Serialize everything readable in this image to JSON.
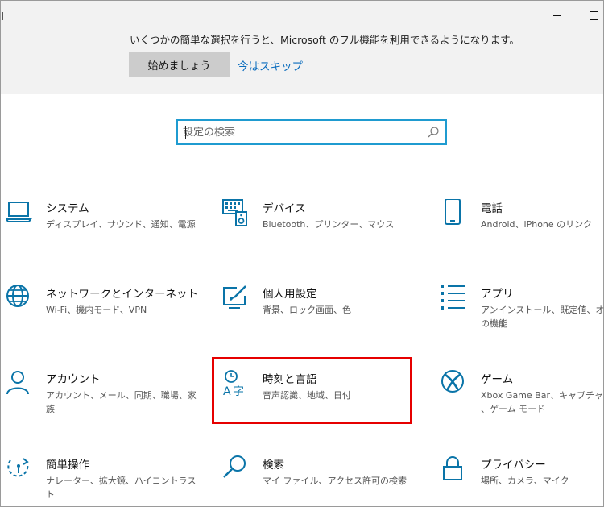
{
  "banner": {
    "message": "いくつかの簡単な選択を行うと、Microsoft のフル機能を利用できるようになります。",
    "start_label": "始めましょう",
    "skip_label": "今はスキップ"
  },
  "search": {
    "placeholder": "設定の検索"
  },
  "colors": {
    "accent": "#0a74a8",
    "link": "#0a6cbd",
    "highlight": "#e60000"
  },
  "tiles": [
    {
      "title": "システム",
      "desc": "ディスプレイ、サウンド、通知、電源",
      "icon": "laptop-icon"
    },
    {
      "title": "デバイス",
      "desc": "Bluetooth、プリンター、マウス",
      "icon": "keyboard-speaker-icon"
    },
    {
      "title": "電話",
      "desc": "Android、iPhone のリンク",
      "icon": "phone-icon"
    },
    {
      "title": "ネットワークとインターネット",
      "desc": "Wi-Fi、機内モード、VPN",
      "icon": "globe-icon"
    },
    {
      "title": "個人用設定",
      "desc": "背景、ロック画面、色",
      "icon": "paint-brush-icon"
    },
    {
      "title": "アプリ",
      "desc": "アンインストール、既定値、オプショ\nの機能",
      "icon": "app-list-icon"
    },
    {
      "title": "アカウント",
      "desc": "アカウント、メール、同期、職場、家\n族",
      "icon": "person-icon"
    },
    {
      "title": "時刻と言語",
      "desc": "音声認識、地域、日付",
      "icon": "time-language-icon"
    },
    {
      "title": "ゲーム",
      "desc": "Xbox Game Bar、キャプチャ、ゲ\n、ゲーム モード",
      "icon": "xbox-icon"
    },
    {
      "title": "簡単操作",
      "desc": "ナレーター、拡大鏡、ハイコントラスト",
      "icon": "ease-of-access-icon"
    },
    {
      "title": "検索",
      "desc": "マイ ファイル、アクセス許可の検索",
      "icon": "search-icon"
    },
    {
      "title": "プライバシー",
      "desc": "場所、カメラ、マイク",
      "icon": "lock-icon"
    }
  ]
}
